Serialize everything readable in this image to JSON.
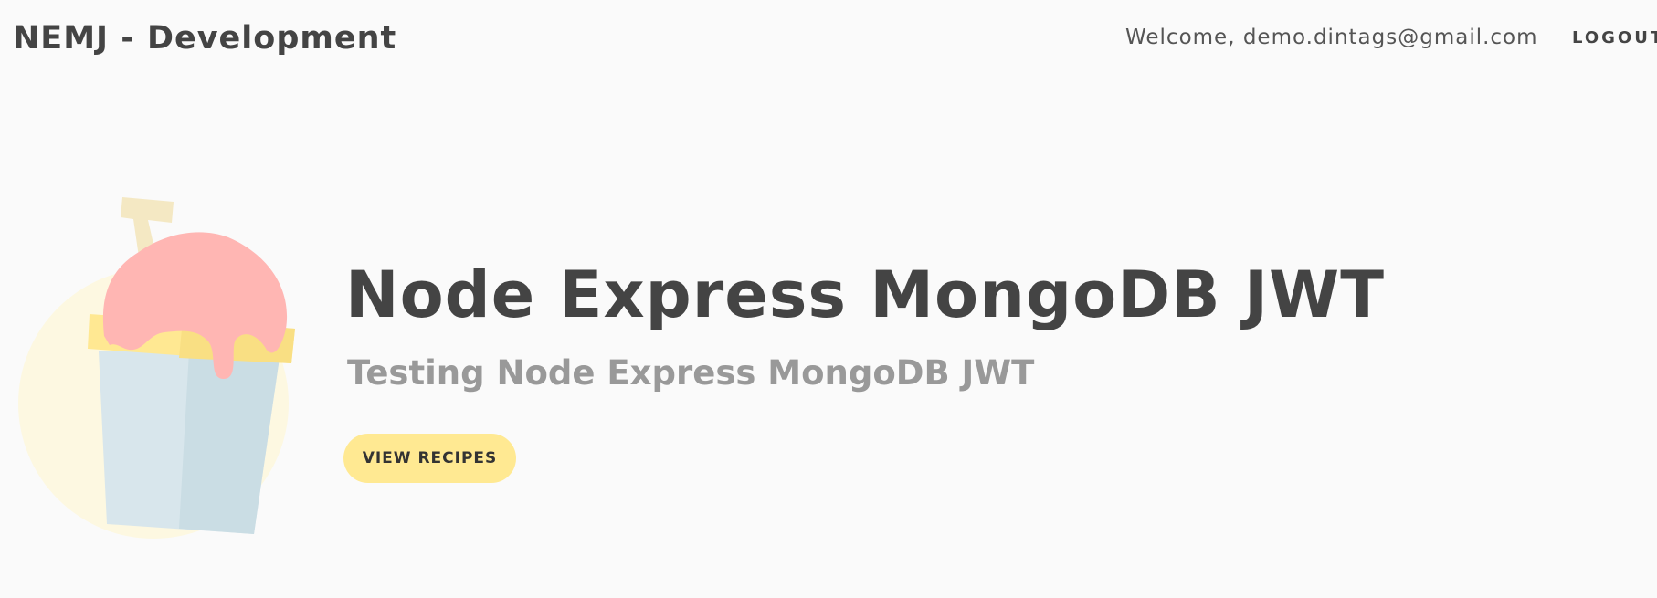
{
  "header": {
    "brand": "NEMJ - Development",
    "welcome_text": "Welcome, demo.dintags@gmail.com",
    "logout_label": "LOGOUT"
  },
  "hero": {
    "title": "Node Express MongoDB JWT",
    "subtitle": "Testing Node Express MongoDB JWT",
    "cta_label": "VIEW RECIPES",
    "illustration_icon": "milkshake-cup-icon"
  },
  "colors": {
    "background": "#fafafa",
    "text_primary": "#444444",
    "text_secondary": "#999999",
    "button_bg": "#ffe992",
    "illustration_circle": "#fdf8e1",
    "illustration_cup": "#d8e6ec",
    "illustration_cup_shade": "#cadde4",
    "illustration_lid": "#ffe892",
    "illustration_cream": "#ffb6b3",
    "illustration_straw": "#f4e8c3"
  }
}
